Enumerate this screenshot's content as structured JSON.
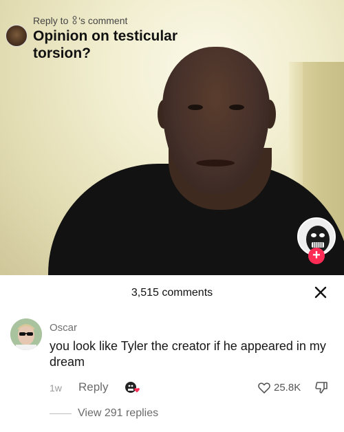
{
  "reply_banner": {
    "prefix": "Reply to",
    "suffix": "'s comment",
    "title": "Opinion on testicular torsion?"
  },
  "comments_sheet": {
    "count_label": "3,515 comments",
    "close_icon": "close-icon"
  },
  "comment": {
    "username": "Oscar",
    "text": "you look like Tyler the creator if he appeared in my dream",
    "time": "1w",
    "reply_label": "Reply",
    "like_count": "25.8K",
    "view_replies": "View 291 replies"
  },
  "colors": {
    "accent": "#fe2c55",
    "creator_heart": "#fe2c55"
  }
}
